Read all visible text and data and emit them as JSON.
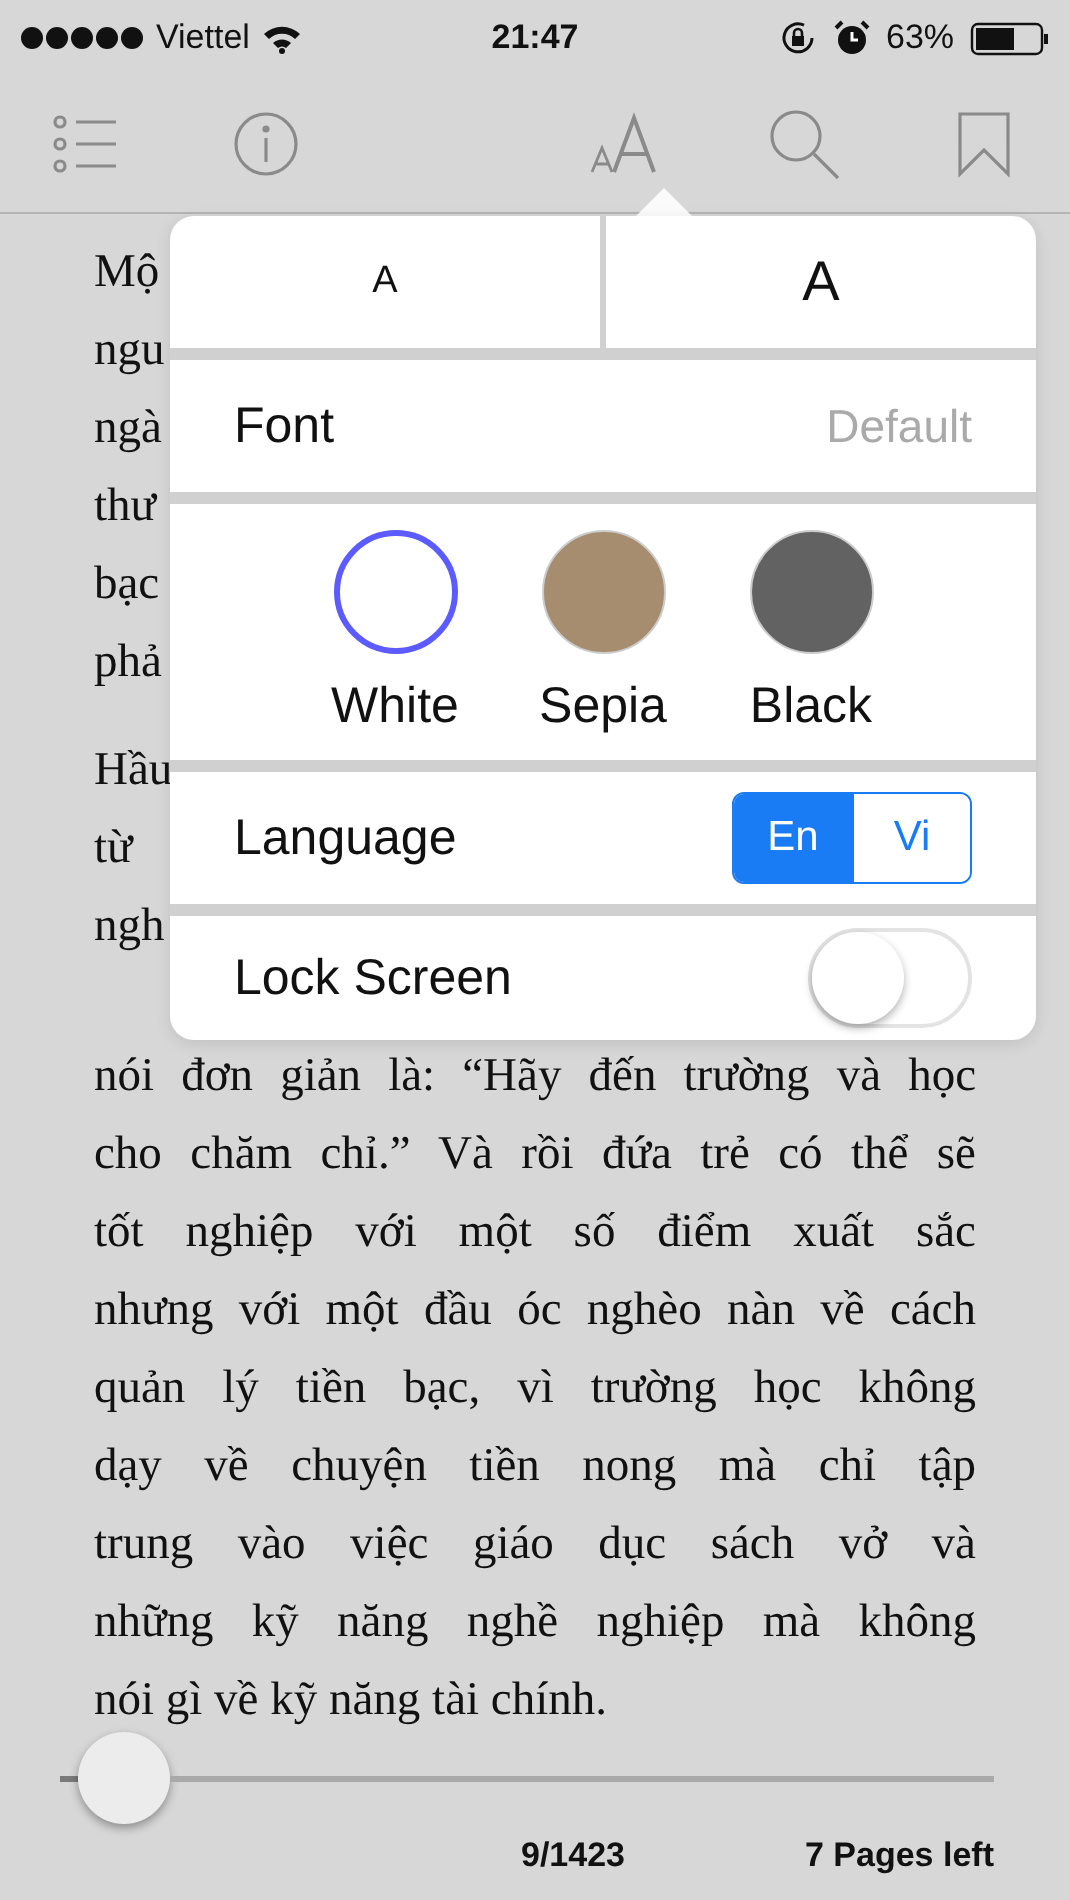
{
  "status_bar": {
    "carrier": "Viettel",
    "time": "21:47",
    "battery": "63%"
  },
  "page": {
    "paragraphs": [
      [
        "Mộ",
        "ngu",
        "ngà",
        "thư",
        "bạc",
        "phả"
      ],
      [
        "Hầu",
        "từ",
        "ngh",
        "nói đơn giản là: “Hãy đến trường và học",
        "cho chăm chỉ.” Và rồi đứa trẻ có thể sẽ",
        "tốt nghiệp với một số điểm xuất sắc",
        "nhưng với một đầu óc nghèo nàn về cách",
        "quản lý tiền bạc, vì trường học không",
        "dạy về chuyện tiền nong mà chỉ tập",
        "trung vào việc giáo dục sách vở và",
        "những kỹ năng nghề nghiệp mà không",
        "nói gì về kỹ năng tài chính."
      ]
    ]
  },
  "settings_popup": {
    "font_sizes": [
      {
        "label": "A",
        "kind": "smaller"
      },
      {
        "label": "A",
        "kind": "larger"
      }
    ],
    "font": {
      "label": "Font",
      "value": "Default"
    },
    "themes": [
      {
        "label": "White",
        "color": "#ffffff",
        "selected": true
      },
      {
        "label": "Sepia",
        "color": "#a78d6f",
        "selected": false
      },
      {
        "label": "Black",
        "color": "#626262",
        "selected": false
      }
    ],
    "language": {
      "label": "Language",
      "options": [
        {
          "label": "En",
          "selected": true
        },
        {
          "label": "Vi",
          "selected": false
        }
      ]
    },
    "lock_screen": {
      "label": "Lock Screen",
      "on": false
    }
  },
  "footer": {
    "progress": {
      "level": 0.02
    },
    "page": "9/1423",
    "remaining": "7 Pages left"
  }
}
